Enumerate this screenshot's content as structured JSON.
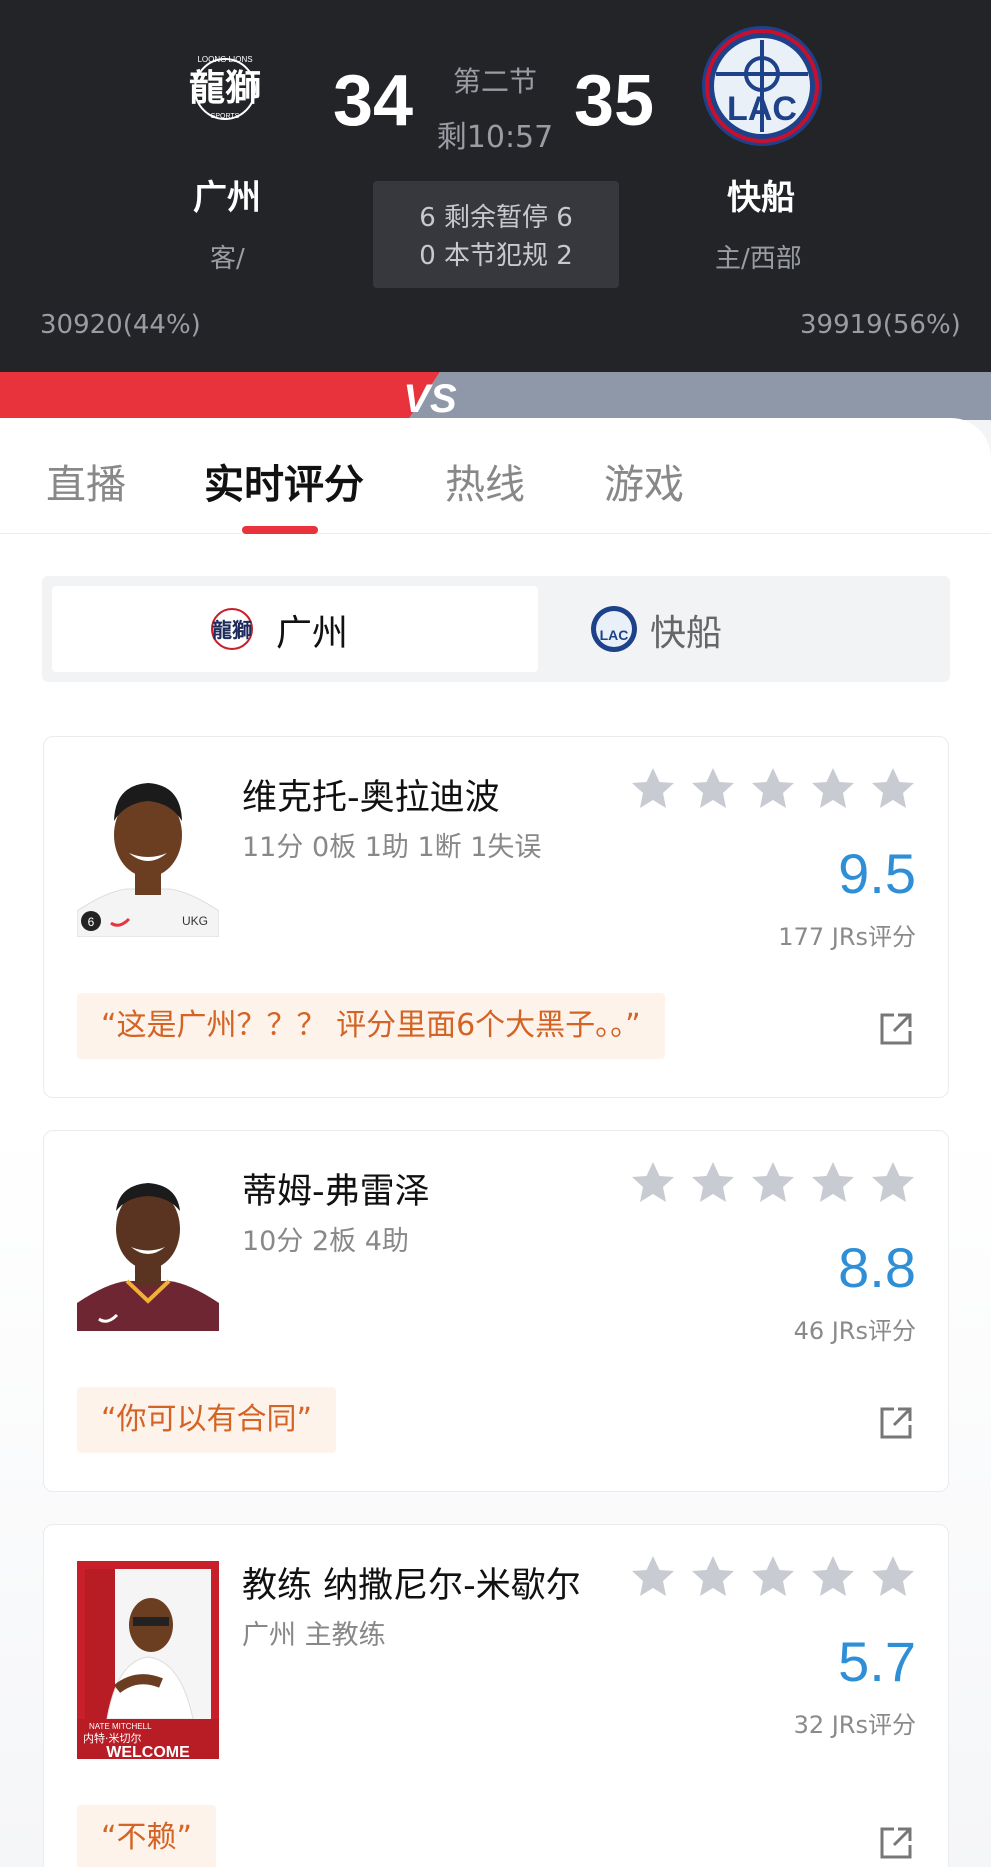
{
  "game": {
    "away_score": "34",
    "home_score": "35",
    "period": "第二节",
    "clock": "剩10:57",
    "away_name": "广州",
    "home_name": "快船",
    "away_sub": "客/",
    "home_sub": "主/西部",
    "info_line1": "6 剩余暂停 6",
    "info_line2": "0 本节犯规 2",
    "away_votes": "30920(44%)",
    "home_votes": "39919(56%)",
    "vs_text": "VS",
    "away_logo_text": "龍獅",
    "away_logo_top": "LOONG LIONS",
    "away_logo_bottom": "SPORTS",
    "home_logo_text": "LAC",
    "colors": {
      "away": "#e8323c",
      "home": "#8e98a9",
      "rating": "#2e8fd6"
    }
  },
  "tabs": [
    {
      "label": "直播"
    },
    {
      "label": "实时评分"
    },
    {
      "label": "热线"
    },
    {
      "label": "游戏"
    }
  ],
  "team_switch": {
    "active_label": "广州",
    "inactive_label": "快船"
  },
  "players": [
    {
      "name": "维克托-奥拉迪波",
      "stats": "11分 0板 1助 1断 1失误",
      "rating": "9.5",
      "count": "177 JRs评分",
      "comment": "“这是广州？？？ 评分里面6个大黑子。。”",
      "jersey_number": "6",
      "jersey_text": "UKG"
    },
    {
      "name": "蒂姆-弗雷泽",
      "stats": "10分 2板 4助",
      "rating": "8.8",
      "count": "46 JRs评分",
      "comment": "“你可以有合同”"
    },
    {
      "name": "教练 纳撒尼尔-米歇尔",
      "stats": "广州 主教练",
      "rating": "5.7",
      "count": "32 JRs评分",
      "comment": "“不赖”",
      "photo_caption_1": "NATE MITCHELL",
      "photo_caption_2": "内特·米切尔",
      "photo_caption_3": "WELCOME"
    }
  ]
}
